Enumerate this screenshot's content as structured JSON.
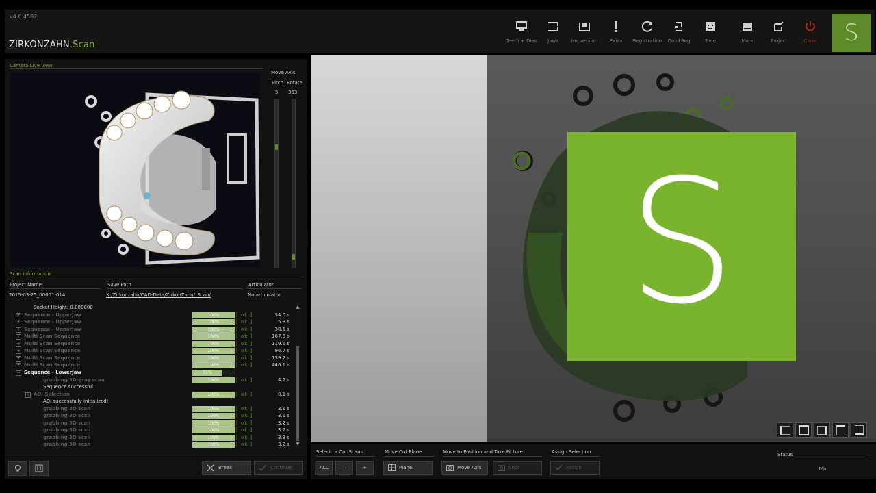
{
  "app": {
    "version": "v4.0.4582",
    "logo_main": "ZIRKONZAHN",
    "logo_sub": ".Scan",
    "s_button": "S"
  },
  "toolbar": {
    "items": [
      {
        "label": "Teeth + Dies",
        "icon": "teeth-dies-icon"
      },
      {
        "label": "Jaws",
        "icon": "jaws-icon"
      },
      {
        "label": "Impression",
        "icon": "impression-icon"
      },
      {
        "label": "Extra",
        "icon": "extra-icon"
      },
      {
        "label": "Registration",
        "icon": "registration-icon"
      },
      {
        "label": "QuickReg",
        "icon": "quickreg-icon"
      },
      {
        "label": "Face",
        "icon": "face-icon"
      }
    ],
    "right_items": [
      {
        "label": "More",
        "icon": "more-icon"
      },
      {
        "label": "Project",
        "icon": "project-icon"
      },
      {
        "label": "Close",
        "icon": "close-icon",
        "color": "#b3261e"
      }
    ]
  },
  "camera": {
    "title": "Camera Live View"
  },
  "move_axis": {
    "title": "Move Axis",
    "pitch_label": "Pitch",
    "rotate_label": "Rotate",
    "pitch_value": "5",
    "rotate_value": "353"
  },
  "scan_info": {
    "title": "Scan Information",
    "project_name_label": "Project Name",
    "save_path_label": "Save Path",
    "articulator_label": "Articulator",
    "project_name": "2015-03-25_00001-014",
    "save_path": "X:/Zirkonzahn/CAD-Data/ZirkonZahn/_Scan/",
    "articulator": "No articulator"
  },
  "scan_rows": [
    {
      "name": "Socket Height: 0.000000",
      "kind": "msg",
      "indent": 1
    },
    {
      "name": "Sequence - UpperJaw",
      "kind": "dim",
      "indent": 0,
      "expander": "+",
      "pct": "100%",
      "progress": 1.0,
      "ok": "[ ok ]",
      "time": "34.0 s"
    },
    {
      "name": "Sequence - UpperJaw",
      "kind": "dim",
      "indent": 0,
      "expander": "+",
      "pct": "100%",
      "progress": 1.0,
      "ok": "[ ok ]",
      "time": "5.3 s"
    },
    {
      "name": "Sequence - UpperJaw",
      "kind": "dim",
      "indent": 0,
      "expander": "+",
      "pct": "100%",
      "progress": 1.0,
      "ok": "[ ok ]",
      "time": "38.1 s"
    },
    {
      "name": "Multi Scan Sequence",
      "kind": "dim",
      "indent": 0,
      "expander": "+",
      "pct": "100%",
      "progress": 1.0,
      "ok": "[ ok ]",
      "time": "167.6 s"
    },
    {
      "name": "Multi Scan Sequence",
      "kind": "dim",
      "indent": 0,
      "expander": "+",
      "pct": "100%",
      "progress": 1.0,
      "ok": "[ ok ]",
      "time": "119.6 s"
    },
    {
      "name": "Multi Scan Sequence",
      "kind": "dim",
      "indent": 0,
      "expander": "+",
      "pct": "100%",
      "progress": 1.0,
      "ok": "[ ok ]",
      "time": "96.7 s"
    },
    {
      "name": "Multi Scan Sequence",
      "kind": "dim",
      "indent": 0,
      "expander": "+",
      "pct": "100%",
      "progress": 1.0,
      "ok": "[ ok ]",
      "time": "139.2 s"
    },
    {
      "name": "Multi Scan Sequence",
      "kind": "dim",
      "indent": 0,
      "expander": "+",
      "pct": "100%",
      "progress": 1.0,
      "ok": "[ ok ]",
      "time": "446.1 s"
    },
    {
      "name": "Sequence - LowerJaw",
      "kind": "bright",
      "indent": 0,
      "expander": "−",
      "pct": "71%",
      "progress": 0.71
    },
    {
      "name": "grabbing 3D-gray scan",
      "kind": "dim",
      "indent": 2,
      "pct": "100%",
      "progress": 1.0,
      "ok": "[ ok ]",
      "time": "4.7 s"
    },
    {
      "name": "Sequence successful!",
      "kind": "msg",
      "indent": 2
    },
    {
      "name": "AOI Selection",
      "kind": "dim",
      "indent": 1,
      "expander": "+",
      "pct": "100%",
      "progress": 1.0,
      "ok": "[ ok ]",
      "time": "0.1 s"
    },
    {
      "name": "AOI successfully initialized!",
      "kind": "msg",
      "indent": 2
    },
    {
      "name": "grabbing 3D scan",
      "kind": "dim",
      "indent": 2,
      "pct": "100%",
      "progress": 1.0,
      "ok": "[ ok ]",
      "time": "3.1 s"
    },
    {
      "name": "grabbing 3D scan",
      "kind": "dim",
      "indent": 2,
      "pct": "100%",
      "progress": 1.0,
      "ok": "[ ok ]",
      "time": "3.1 s"
    },
    {
      "name": "grabbing 3D scan",
      "kind": "dim",
      "indent": 2,
      "pct": "100%",
      "progress": 1.0,
      "ok": "[ ok ]",
      "time": "3.2 s"
    },
    {
      "name": "grabbing 3D scan",
      "kind": "dim",
      "indent": 2,
      "pct": "100%",
      "progress": 1.0,
      "ok": "[ ok ]",
      "time": "3.2 s"
    },
    {
      "name": "grabbing 3D scan",
      "kind": "dim",
      "indent": 2,
      "pct": "100%",
      "progress": 1.0,
      "ok": "[ ok ]",
      "time": "3.3 s"
    },
    {
      "name": "grabbing 3D scan",
      "kind": "dim",
      "indent": 2,
      "pct": "100%",
      "progress": 1.0,
      "ok": "[ ok ]",
      "time": "3.2 s"
    }
  ],
  "left_actions": {
    "break_label": "Break",
    "continue_label": "Continue"
  },
  "viewport": {
    "logo_letter": "S",
    "logo_color": "#7ab32e"
  },
  "bottom_toolbar": {
    "select_cut_title": "Select or Cut Scans",
    "all_label": "ALL",
    "minus_label": "—",
    "plus_label": "+",
    "move_cut_title": "Move Cut Plane",
    "plane_label": "Plane",
    "move_position_title": "Move to Position and Take Picture",
    "move_axis_label": "Move Axis",
    "shot_label": "Shot",
    "assign_title": "Assign Selection",
    "assign_label": "Assign",
    "status_title": "Status",
    "status_value": "0%"
  },
  "colors": {
    "accent": "#7ab32e",
    "background": "#121212"
  }
}
